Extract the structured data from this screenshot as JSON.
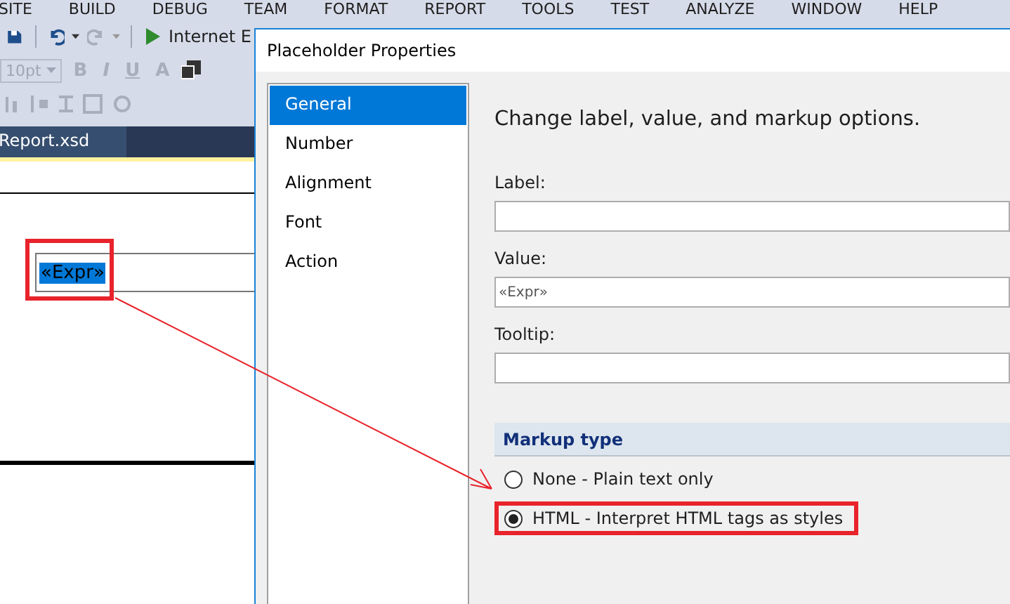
{
  "menu": [
    "SITE",
    "BUILD",
    "DEBUG",
    "TEAM",
    "FORMAT",
    "REPORT",
    "TOOLS",
    "TEST",
    "ANALYZE",
    "WINDOW",
    "HELP"
  ],
  "toolbar": {
    "run_label": "Internet E",
    "font_size": "10pt",
    "format_buttons": [
      "B",
      "I",
      "U",
      "A"
    ]
  },
  "document_tab": "Report.xsd",
  "canvas": {
    "expression": "«Expr»",
    "selected": true,
    "highlighted": true
  },
  "dialog": {
    "title": "Placeholder Properties",
    "nav": [
      {
        "label": "General",
        "selected": true
      },
      {
        "label": "Number",
        "selected": false
      },
      {
        "label": "Alignment",
        "selected": false
      },
      {
        "label": "Font",
        "selected": false
      },
      {
        "label": "Action",
        "selected": false
      }
    ],
    "heading": "Change label, value, and markup options.",
    "fields": [
      {
        "label": "Label:"
      },
      {
        "label": "Value:",
        "value": "«Expr»"
      },
      {
        "label": "Tooltip:"
      }
    ],
    "markup": {
      "title": "Markup type",
      "options": [
        {
          "label": "None - Plain text only",
          "selected": false,
          "highlighted": false
        },
        {
          "label": "HTML - Interpret HTML tags as styles",
          "selected": true,
          "highlighted": true
        }
      ]
    }
  }
}
